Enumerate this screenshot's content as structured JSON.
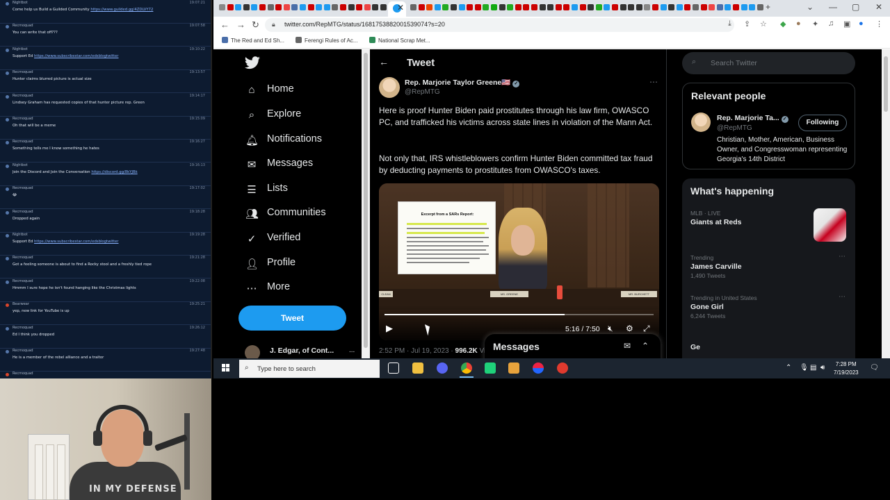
{
  "chat": {
    "messages": [
      {
        "user": "Nightbot",
        "time": "19:07:21",
        "text": "Come help us Build a Guilded Community ",
        "link": "https://www.guilded.gg/4ZDLVY72",
        "dot": "blue"
      },
      {
        "user": "Recmoquad",
        "time": "19:07:58",
        "text": "You can write that off???",
        "link": "",
        "dot": "blue"
      },
      {
        "user": "Nightbot",
        "time": "19:10:22",
        "text": "Support Ed ",
        "link": "https://www.subscribestar.com/edsblogtwitter",
        "dot": "blue"
      },
      {
        "user": "Recmoquad",
        "time": "19:13:57",
        "text": "Hunter claims blurred picture is actual size",
        "link": "",
        "dot": "blue"
      },
      {
        "user": "Recmoquad",
        "time": "19:14:17",
        "text": "Lindsey Graham has requested copies of that hunter picture rep. Green",
        "link": "",
        "dot": "blue"
      },
      {
        "user": "Recmoquad",
        "time": "19:15:09",
        "text": "Oh that will be a meme",
        "link": "",
        "dot": "blue"
      },
      {
        "user": "Recmoquad",
        "time": "19:16:27",
        "text": "Something tells me I know something he hates",
        "link": "",
        "dot": "blue"
      },
      {
        "user": "Nightbot",
        "time": "19:16:13",
        "text": "Join the Discord and Join the Conversation ",
        "link": "https://discord.gg/8kYJBk",
        "dot": "blue"
      },
      {
        "user": "Recmoquad",
        "time": "19:17:02",
        "text": "😂",
        "link": "",
        "dot": "blue"
      },
      {
        "user": "Recmoquad",
        "time": "19:18:28",
        "text": "Dropped again",
        "link": "",
        "dot": "blue"
      },
      {
        "user": "Nightbot",
        "time": "19:19:28",
        "text": "Support Ed ",
        "link": "https://www.subscribestar.com/edsblogtwitter",
        "dot": "blue"
      },
      {
        "user": "Recmoquad",
        "time": "19:21:28",
        "text": "Got a feeling someone is about to find a Rocky stool and a freshly tied rope",
        "link": "",
        "dot": "blue"
      },
      {
        "user": "Recmoquad",
        "time": "19:22:08",
        "text": "Hmmm I sure hope he isn't found hanging like the Christmas lights",
        "link": "",
        "dot": "blue"
      },
      {
        "user": "Bearwear",
        "time": "19:25:21",
        "text": "yep, new link for YouTube is up",
        "link": "",
        "dot": "red"
      },
      {
        "user": "Recmoquad",
        "time": "19:26:12",
        "text": "Ed I think you dropped",
        "link": "",
        "dot": "blue"
      },
      {
        "user": "Recmoquad",
        "time": "19:27:48",
        "text": "He is a member of the rebel alliance and a traitor",
        "link": "",
        "dot": "blue"
      },
      {
        "user": "Recmoquad",
        "time": "",
        "text": "",
        "link": "",
        "dot": "red"
      }
    ]
  },
  "webcam": {
    "shirt_text": "IN MY DEFENSE"
  },
  "browser": {
    "url": "twitter.com/RepMTG/status/1681753882001539074?s=20",
    "bookmarks": [
      {
        "label": "The Red and Ed Sh...",
        "color": "#4a6ea9"
      },
      {
        "label": "Ferengi Rules of Ac...",
        "color": "#666666"
      },
      {
        "label": "National Scrap Met...",
        "color": "#2e8b57"
      }
    ],
    "window_controls": {
      "minimize": "—",
      "maximize": "▢",
      "close": "✕"
    }
  },
  "twitter": {
    "nav": {
      "items": [
        {
          "icon": "home-icon",
          "glyph": "⌂",
          "label": "Home"
        },
        {
          "icon": "explore-icon",
          "glyph": "⌕",
          "label": "Explore"
        },
        {
          "icon": "bell-icon",
          "glyph": "🔔︎",
          "label": "Notifications"
        },
        {
          "icon": "envelope-icon",
          "glyph": "✉",
          "label": "Messages"
        },
        {
          "icon": "list-icon",
          "glyph": "☰",
          "label": "Lists"
        },
        {
          "icon": "communities-icon",
          "glyph": "👥︎",
          "label": "Communities"
        },
        {
          "icon": "verified-icon",
          "glyph": "✓",
          "label": "Verified"
        },
        {
          "icon": "profile-icon",
          "glyph": "👤︎",
          "label": "Profile"
        },
        {
          "icon": "more-icon",
          "glyph": "⋯",
          "label": "More"
        }
      ],
      "tweet_button": "Tweet",
      "account_name": "J. Edgar, of Cont...",
      "account_more": "..."
    },
    "header": {
      "title": "Tweet"
    },
    "tweet": {
      "author_name": "Rep. Marjorie Taylor Greene🇺🇸",
      "author_handle": "@RepMTG",
      "paragraph_1": "Here is proof Hunter Biden paid prostitutes through his law firm, OWASCO PC, and trafficked his victims across state lines in violation of the Mann Act.",
      "paragraph_2": "Not only that, IRS whistleblowers confirm Hunter Biden committed tax fraud by deducting payments to prostitutes from OWASCO's taxes.",
      "video": {
        "doc_title": "Excerpt from a SARs Report:",
        "time": "5:16 / 7:50",
        "progress": 0.67,
        "nameplates": [
          "CLEAN",
          "MS. GREENE",
          "MR. BURCHETT"
        ]
      },
      "time": "2:52 PM · Jul 19, 2023 · ",
      "views_count": "996.2K",
      "views_label": " Views"
    },
    "right": {
      "search_placeholder": "Search Twitter",
      "relevant_title": "Relevant people",
      "relevant_person": {
        "name": "Rep. Marjorie Ta...",
        "handle": "@RepMTG",
        "follow_label": "Following",
        "bio": "Christian, Mother, American, Business Owner, and Congresswoman representing Georgia's 14th District"
      },
      "happening_title": "What's happening",
      "trends": [
        {
          "context": "MLB · LIVE",
          "name": "Giants at Reds",
          "count": ""
        },
        {
          "context": "Trending",
          "name": "James Carville",
          "count": "1,490 Tweets"
        },
        {
          "context": "Trending in United States",
          "name": "Gone Girl",
          "count": "6,244 Tweets"
        },
        {
          "context": "",
          "name": "Ge",
          "count": ""
        }
      ],
      "messages_title": "Messages"
    }
  },
  "taskbar": {
    "search_placeholder": "Type here to search",
    "clock_time": "7:28 PM",
    "clock_date": "7/19/2023"
  }
}
